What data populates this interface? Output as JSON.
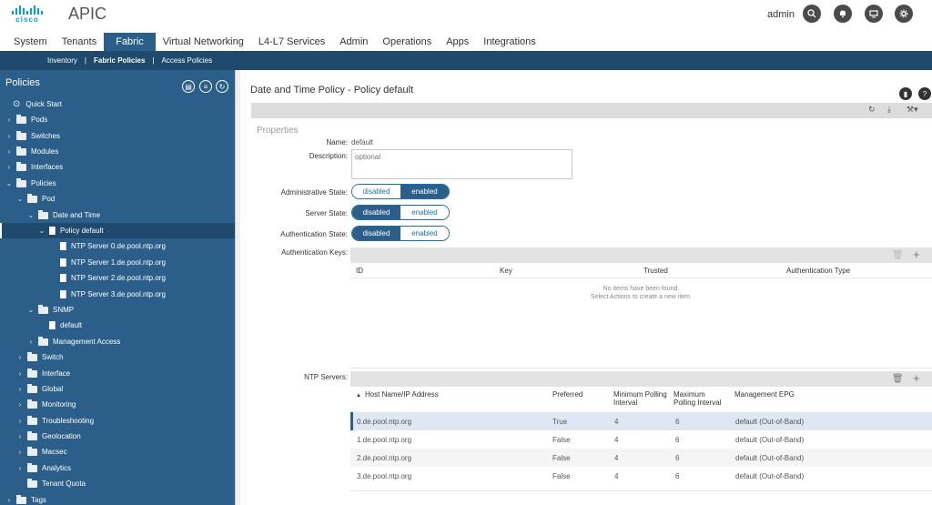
{
  "header": {
    "brand": "cisco",
    "app_title": "APIC",
    "user": "admin",
    "icons": [
      "search-icon",
      "bell-icon",
      "monitor-icon",
      "gear-icon"
    ]
  },
  "tabs": [
    {
      "label": "System"
    },
    {
      "label": "Tenants"
    },
    {
      "label": "Fabric"
    },
    {
      "label": "Virtual Networking"
    },
    {
      "label": "L4-L7 Services"
    },
    {
      "label": "Admin"
    },
    {
      "label": "Operations"
    },
    {
      "label": "Apps"
    },
    {
      "label": "Integrations"
    }
  ],
  "subnav": [
    {
      "label": "Inventory"
    },
    {
      "label": "Fabric Policies"
    },
    {
      "label": "Access Policies"
    }
  ],
  "sidebar": {
    "title": "Policies",
    "tree": [
      {
        "label": "Quick Start"
      },
      {
        "label": "Pods"
      },
      {
        "label": "Switches"
      },
      {
        "label": "Modules"
      },
      {
        "label": "Interfaces"
      },
      {
        "label": "Policies"
      },
      {
        "label": "Pod"
      },
      {
        "label": "Date and Time"
      },
      {
        "label": "Policy default"
      },
      {
        "label": "NTP Server 0.de.pool.ntp.org"
      },
      {
        "label": "NTP Server 1.de.pool.ntp.org"
      },
      {
        "label": "NTP Server 2.de.pool.ntp.org"
      },
      {
        "label": "NTP Server 3.de.pool.ntp.org"
      },
      {
        "label": "SNMP"
      },
      {
        "label": "default"
      },
      {
        "label": "Management Access"
      },
      {
        "label": "Switch"
      },
      {
        "label": "Interface"
      },
      {
        "label": "Global"
      },
      {
        "label": "Monitoring"
      },
      {
        "label": "Troubleshooting"
      },
      {
        "label": "Geolocation"
      },
      {
        "label": "Macsec"
      },
      {
        "label": "Analytics"
      },
      {
        "label": "Tenant Quota"
      },
      {
        "label": "Tags"
      }
    ]
  },
  "content": {
    "title": "Date and Time Policy - Policy default",
    "properties_label": "Properties",
    "name": {
      "label": "Name:",
      "value": "default"
    },
    "description": {
      "label": "Description:",
      "placeholder": "optional"
    },
    "admin_state": {
      "label": "Administrative State:",
      "options": [
        "disabled",
        "enabled"
      ],
      "selected": "enabled"
    },
    "server_state": {
      "label": "Server State:",
      "options": [
        "disabled",
        "enabled"
      ],
      "selected": "disabled"
    },
    "auth_state": {
      "label": "Authentication State:",
      "options": [
        "disabled",
        "enabled"
      ],
      "selected": "disabled"
    },
    "auth_keys": {
      "label": "Authentication Keys:",
      "columns": [
        "ID",
        "Key",
        "Trusted",
        "Authentication Type"
      ],
      "empty_line1": "No items have been found.",
      "empty_line2": "Select Actions to create a new item."
    },
    "ntp": {
      "label": "NTP Servers:",
      "columns": [
        "Host Name/IP Address",
        "Preferred",
        "Minimum Polling Interval",
        "Maximum Polling Interval",
        "Management EPG"
      ],
      "rows": [
        {
          "host": "0.de.pool.ntp.org",
          "preferred": "True",
          "min": "4",
          "max": "6",
          "epg": "default (Out-of-Band)"
        },
        {
          "host": "1.de.pool.ntp.org",
          "preferred": "False",
          "min": "4",
          "max": "6",
          "epg": "default (Out-of-Band)"
        },
        {
          "host": "2.de.pool.ntp.org",
          "preferred": "False",
          "min": "4",
          "max": "6",
          "epg": "default (Out-of-Band)"
        },
        {
          "host": "3.de.pool.ntp.org",
          "preferred": "False",
          "min": "4",
          "max": "6",
          "epg": "default (Out-of-Band)"
        }
      ]
    }
  }
}
